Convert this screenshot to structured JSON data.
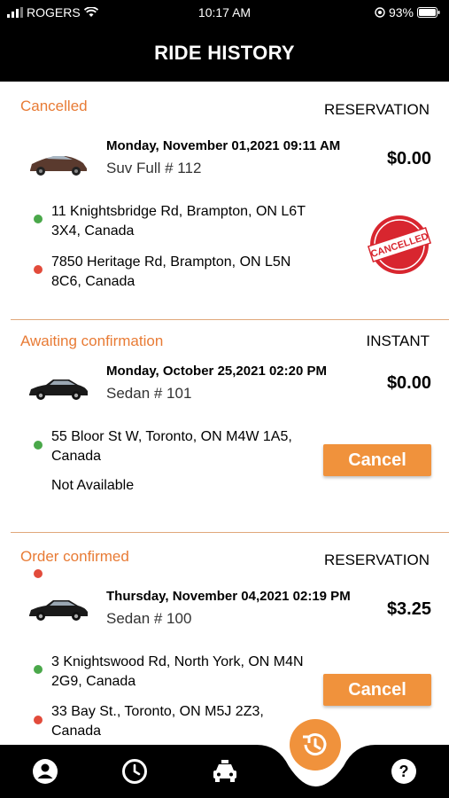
{
  "status_bar": {
    "carrier": "ROGERS",
    "time": "10:17 AM",
    "battery": "93%"
  },
  "header": {
    "title": "RIDE HISTORY"
  },
  "rides": [
    {
      "status": "Cancelled",
      "type": "RESERVATION",
      "date": "Monday, November 01,2021 09:11 AM",
      "vehicle": "Suv Full  # 112",
      "price": "$0.00",
      "pickup": "11 Knightsbridge Rd, Brampton, ON L6T 3X4, Canada",
      "dropoff": "7850 Heritage Rd, Brampton, ON L5N 8C6, Canada",
      "stamp_text": "CANCELLED"
    },
    {
      "status": "Awaiting confirmation",
      "type": "INSTANT",
      "date": "Monday, October 25,2021 02:20 PM",
      "vehicle": "Sedan  # 101",
      "price": "$0.00",
      "pickup": "55 Bloor St W, Toronto, ON M4W 1A5, Canada",
      "dropoff": "Not Available",
      "button": "Cancel"
    },
    {
      "status": "Order confirmed",
      "type": "RESERVATION",
      "date": "Thursday, November 04,2021 02:19 PM",
      "vehicle": "Sedan  # 100",
      "price": "$3.25",
      "pickup": "3 Knightswood Rd, North York, ON M4N 2G9, Canada",
      "dropoff": "33 Bay St., Toronto, ON M5J 2Z3, Canada",
      "button": "Cancel"
    }
  ],
  "tabs": [
    {
      "icon": "profile-icon"
    },
    {
      "icon": "clock-icon"
    },
    {
      "icon": "taxi-icon"
    },
    {
      "icon": "history-icon",
      "active": true
    },
    {
      "icon": "help-icon"
    }
  ],
  "colors": {
    "accent": "#f0923c",
    "status_text": "#e87b35",
    "pickup_dot": "#4aa84a",
    "dropoff_dot": "#e24b3b"
  }
}
